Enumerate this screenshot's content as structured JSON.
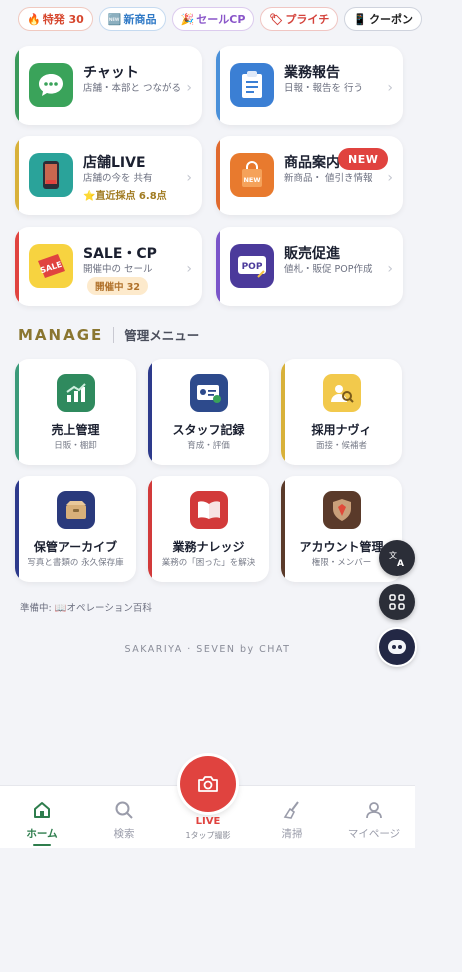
{
  "chips": [
    {
      "icon": "🔥",
      "label": "特発 30"
    },
    {
      "icon": "🆕",
      "label": "新商品"
    },
    {
      "icon": "🎉",
      "label": "セールCP"
    },
    {
      "icon": "🏷",
      "label": "プライチ"
    },
    {
      "icon": "📱",
      "label": "クーポン"
    }
  ],
  "features": [
    {
      "title": "チャット",
      "desc": "店舗・本部と つながる",
      "bar": "#3a9a5b"
    },
    {
      "title": "業務報告",
      "desc": "日報・報告を 行う",
      "bar": "#4a90d9"
    },
    {
      "title": "店舗LIVE",
      "desc": "店舗の今を 共有",
      "score": "直近採点 6.8点",
      "bar": "#d8b13a"
    },
    {
      "title": "商品案内",
      "desc": "新商品・ 値引き情報",
      "badge": "NEW",
      "bar": "#e06a2e"
    },
    {
      "title": "SALE・CP",
      "desc": "開催中の セール",
      "pill": "開催中 32",
      "bar": "#e0433f"
    },
    {
      "title": "販売促進",
      "desc": "値札・販促 POP作成",
      "bar": "#7a55c9"
    }
  ],
  "manage": {
    "title": "MANAGE",
    "subtitle": "管理メニュー"
  },
  "manage_items": [
    {
      "title": "売上管理",
      "sub": "日販・棚卸",
      "bar": "#3a9a7a"
    },
    {
      "title": "スタッフ記録",
      "sub": "育成・評価",
      "bar": "#2d3a8c"
    },
    {
      "title": "採用ナヴィ",
      "sub": "面接・候補者",
      "bar": "#d8b13a"
    },
    {
      "title": "保管アーカイブ",
      "sub": "写真と書類の 永久保存庫",
      "bar": "#2d3a8c"
    },
    {
      "title": "業務ナレッジ",
      "sub": "業務の「困った」を解決",
      "bar": "#d23a3a"
    },
    {
      "title": "アカウント管理",
      "sub": "権限・メンバー",
      "bar": "#5a3a2a"
    }
  ],
  "prep_text": "準備中: 📖オペレーション百科",
  "footer": "SAKARIYA · SEVEN by CHAT",
  "tabs": [
    {
      "label": "ホーム"
    },
    {
      "label": "検索"
    },
    {
      "label": "清掃"
    },
    {
      "label": "マイページ"
    }
  ],
  "live": {
    "label": "LIVE",
    "sub": "1タップ撮影"
  },
  "colors": {
    "accent": "#2e7d4d",
    "live": "#e0433f",
    "manage": "#8a7630"
  }
}
